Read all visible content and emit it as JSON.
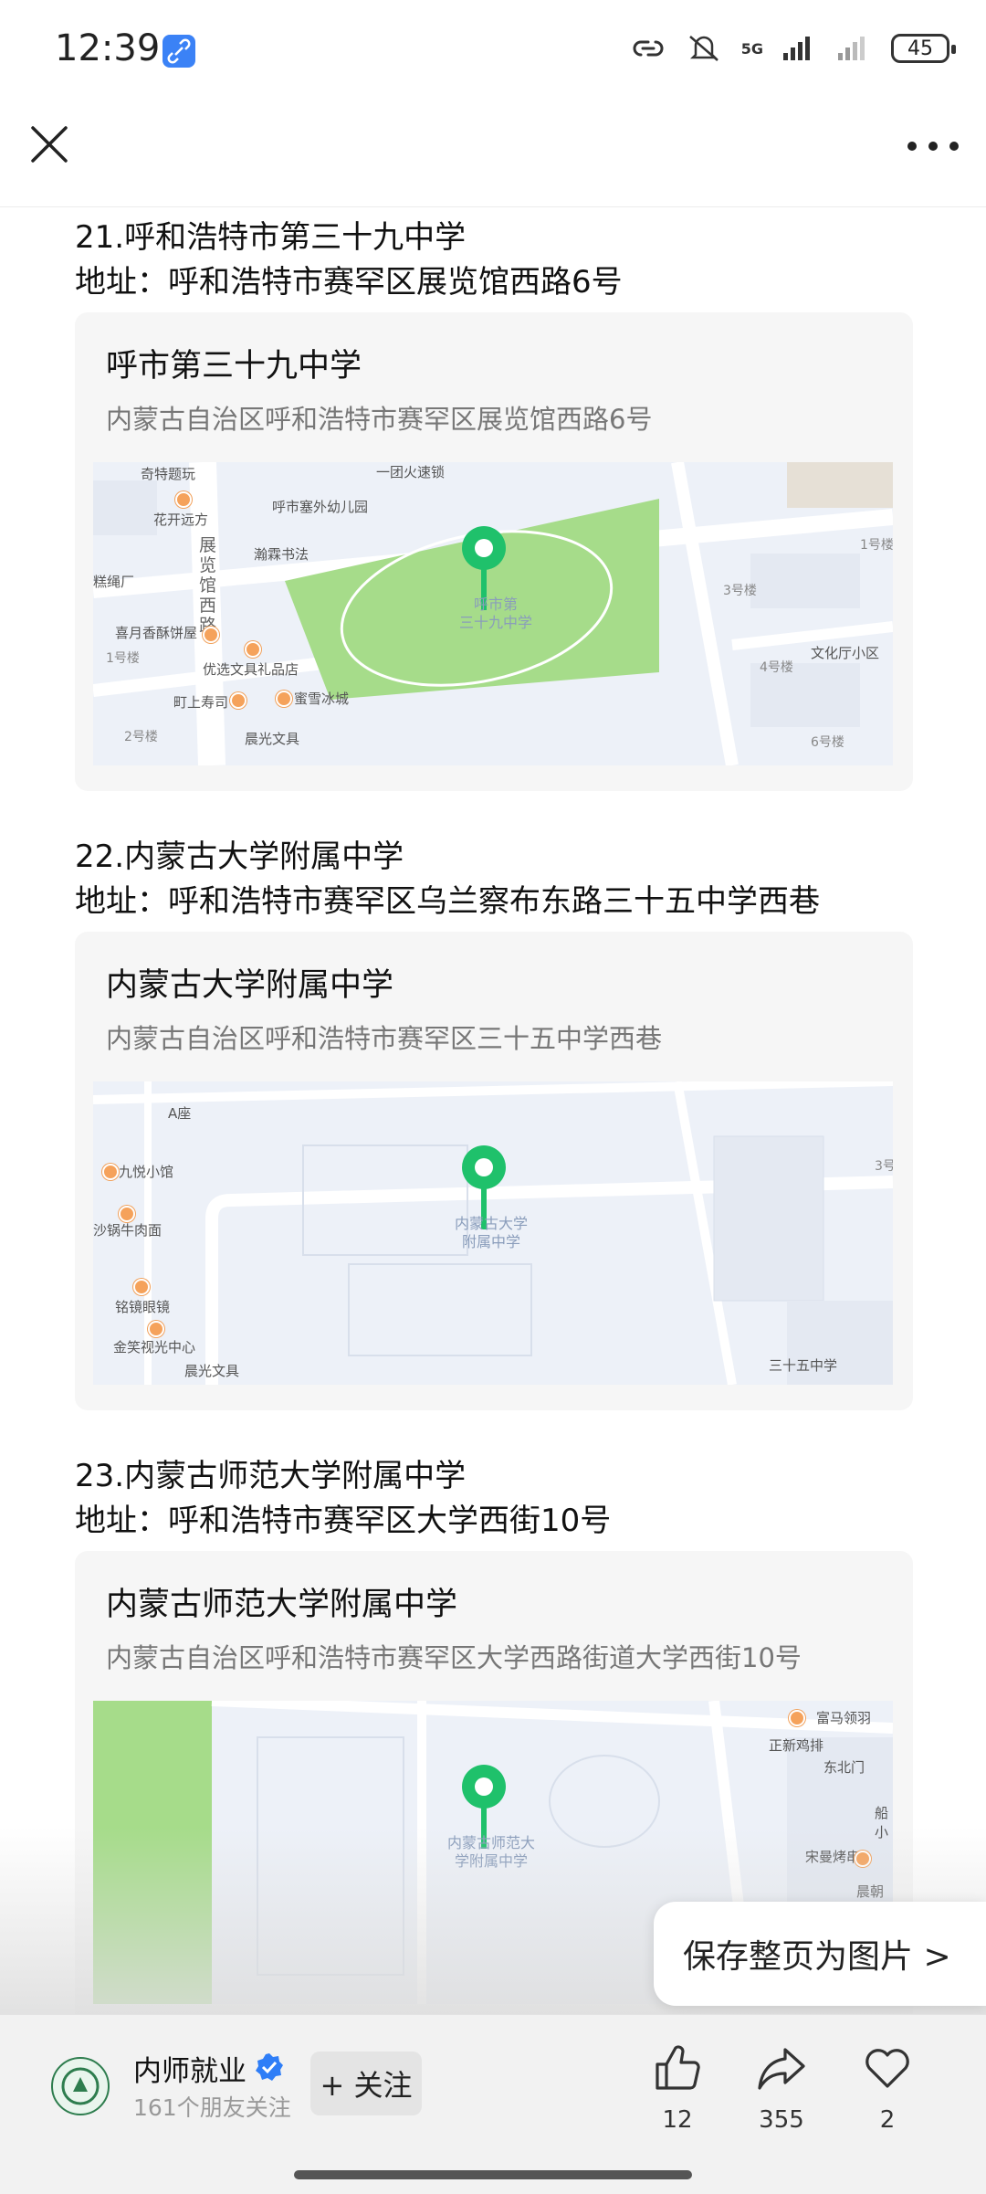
{
  "status_bar": {
    "time": "12:39",
    "network": "5G",
    "battery": "45"
  },
  "top_bar": {
    "close_label": "",
    "more_label": ""
  },
  "entries": [
    {
      "title": "21.呼和浩特市第三十九中学",
      "address": "地址：呼和浩特市赛罕区展览馆西路6号",
      "card_name": "呼市第三十九中学",
      "card_address": "内蒙古自治区呼和浩特市赛罕区展览馆西路6号",
      "map": {
        "pin_label": "呼市第\n三十九中学",
        "labels": [
          "奇特题玩",
          "花开远方",
          "一团火速锁",
          "呼市塞外幼儿园",
          "瀚霖书法",
          "展览馆西路",
          "糕绳厂",
          "喜月香酥饼屋",
          "1号楼",
          "优选文具礼品店",
          "町上寿司",
          "蜜雪冰城",
          "2号楼",
          "晨光文具",
          "3号楼",
          "1号楼",
          "4号楼",
          "文化厅小区",
          "6号楼"
        ]
      }
    },
    {
      "title": "22.内蒙古大学附属中学",
      "address": "地址：呼和浩特市赛罕区乌兰察布东路三十五中学西巷",
      "card_name": "内蒙古大学附属中学",
      "card_address": "内蒙古自治区呼和浩特市赛罕区三十五中学西巷",
      "map": {
        "pin_label": "内蒙古大学\n附属中学",
        "labels": [
          "A座",
          "九悦小馆",
          "沙锅牛肉面",
          "铭镜眼镜",
          "金笑视光中心",
          "晨光文具",
          "三十五中学",
          "3号"
        ]
      }
    },
    {
      "title": "23.内蒙古师范大学附属中学",
      "address": "地址：呼和浩特市赛罕区大学西街10号",
      "card_name": "内蒙古师范大学附属中学",
      "card_address": "内蒙古自治区呼和浩特市赛罕区大学西路街道大学西街10号",
      "map": {
        "pin_label": "内蒙古师范大\n学附属中学",
        "labels": [
          "富马领羽",
          "正新鸡排",
          "东北门",
          "船小",
          "宋曼烤串",
          "晨朝"
        ]
      }
    }
  ],
  "save_page_button": "保存整页为图片 >",
  "bottom_bar": {
    "account_name": "内师就业",
    "follower_text": "161个朋友关注",
    "follow_label": "+ 关注",
    "likes": "12",
    "shares": "355",
    "favorites": "2"
  },
  "colors": {
    "pin": "#1fc16b",
    "park": "#a6dc8a",
    "map_bg": "#edf1f8",
    "verified": "#2f7ef7"
  }
}
